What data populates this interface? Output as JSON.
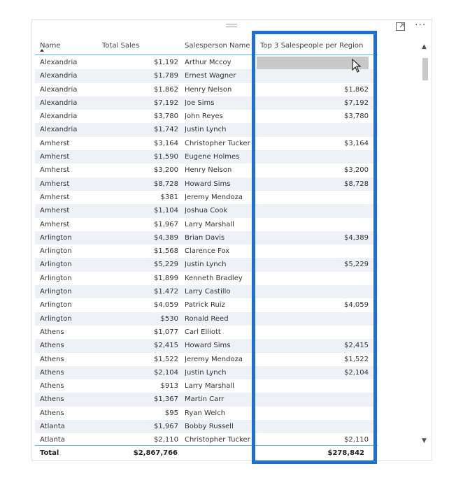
{
  "columns": {
    "city": "Name",
    "sales": "Total Sales",
    "person": "Salesperson Name",
    "top3": "Top 3 Salespeople per Region"
  },
  "rows": [
    {
      "city": "Alexandria",
      "sales": "$1,192",
      "person": "Arthur Mccoy",
      "top3": ""
    },
    {
      "city": "Alexandria",
      "sales": "$1,789",
      "person": "Ernest Wagner",
      "top3": ""
    },
    {
      "city": "Alexandria",
      "sales": "$1,862",
      "person": "Henry Nelson",
      "top3": "$1,862"
    },
    {
      "city": "Alexandria",
      "sales": "$7,192",
      "person": "Joe Sims",
      "top3": "$7,192"
    },
    {
      "city": "Alexandria",
      "sales": "$3,780",
      "person": "John Reyes",
      "top3": "$3,780"
    },
    {
      "city": "Alexandria",
      "sales": "$1,742",
      "person": "Justin Lynch",
      "top3": ""
    },
    {
      "city": "Amherst",
      "sales": "$3,164",
      "person": "Christopher Tucker",
      "top3": "$3,164"
    },
    {
      "city": "Amherst",
      "sales": "$1,590",
      "person": "Eugene Holmes",
      "top3": ""
    },
    {
      "city": "Amherst",
      "sales": "$3,200",
      "person": "Henry Nelson",
      "top3": "$3,200"
    },
    {
      "city": "Amherst",
      "sales": "$8,728",
      "person": "Howard Sims",
      "top3": "$8,728"
    },
    {
      "city": "Amherst",
      "sales": "$381",
      "person": "Jeremy Mendoza",
      "top3": ""
    },
    {
      "city": "Amherst",
      "sales": "$1,104",
      "person": "Joshua Cook",
      "top3": ""
    },
    {
      "city": "Amherst",
      "sales": "$1,967",
      "person": "Larry Marshall",
      "top3": ""
    },
    {
      "city": "Arlington",
      "sales": "$4,389",
      "person": "Brian Davis",
      "top3": "$4,389"
    },
    {
      "city": "Arlington",
      "sales": "$1,568",
      "person": "Clarence Fox",
      "top3": ""
    },
    {
      "city": "Arlington",
      "sales": "$5,229",
      "person": "Justin Lynch",
      "top3": "$5,229"
    },
    {
      "city": "Arlington",
      "sales": "$1,899",
      "person": "Kenneth Bradley",
      "top3": ""
    },
    {
      "city": "Arlington",
      "sales": "$1,472",
      "person": "Larry Castillo",
      "top3": ""
    },
    {
      "city": "Arlington",
      "sales": "$4,059",
      "person": "Patrick Ruiz",
      "top3": "$4,059"
    },
    {
      "city": "Arlington",
      "sales": "$530",
      "person": "Ronald Reed",
      "top3": ""
    },
    {
      "city": "Athens",
      "sales": "$1,077",
      "person": "Carl Elliott",
      "top3": ""
    },
    {
      "city": "Athens",
      "sales": "$2,415",
      "person": "Howard Sims",
      "top3": "$2,415"
    },
    {
      "city": "Athens",
      "sales": "$1,522",
      "person": "Jeremy Mendoza",
      "top3": "$1,522"
    },
    {
      "city": "Athens",
      "sales": "$2,104",
      "person": "Justin Lynch",
      "top3": "$2,104"
    },
    {
      "city": "Athens",
      "sales": "$913",
      "person": "Larry Marshall",
      "top3": ""
    },
    {
      "city": "Athens",
      "sales": "$1,367",
      "person": "Martin Carr",
      "top3": ""
    },
    {
      "city": "Athens",
      "sales": "$95",
      "person": "Ryan Welch",
      "top3": ""
    },
    {
      "city": "Atlanta",
      "sales": "$1,967",
      "person": "Bobby Russell",
      "top3": ""
    },
    {
      "city": "Atlanta",
      "sales": "$2,110",
      "person": "Christopher Tucker",
      "top3": "$2,110"
    }
  ],
  "totals": {
    "label": "Total",
    "sales": "$2,867,766",
    "top3": "$278,842"
  },
  "colors": {
    "highlight_frame": "#1f6fd1",
    "header_underline": "#5bb7c7",
    "banded_row": "#eef1f6"
  },
  "icons": {
    "focus": "focus-mode-icon",
    "more": "more-options-icon",
    "sort": "sort-ascending-icon",
    "cursor": "mouse-pointer-icon"
  }
}
